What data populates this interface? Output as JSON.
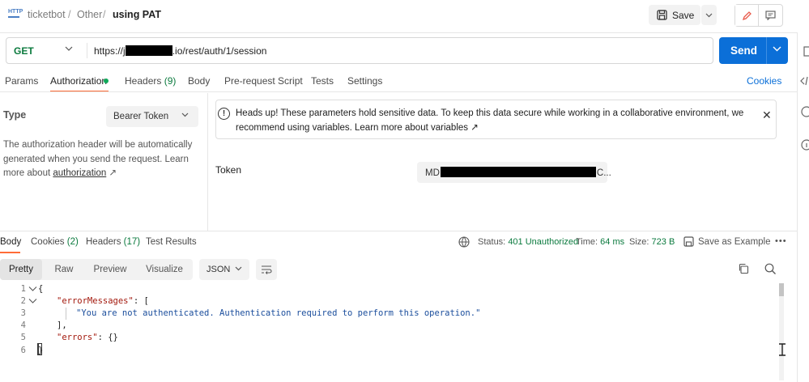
{
  "breadcrumb": {
    "collection": "ticketbot",
    "folder": "Other",
    "request": "using PAT",
    "separator": "/"
  },
  "toolbar": {
    "save_label": "Save"
  },
  "request": {
    "method": "GET",
    "url_prefix": "https://j",
    "url_suffix": ".io/rest/auth/1/session",
    "send_label": "Send"
  },
  "request_tabs": {
    "params": "Params",
    "authorization": "Authorization",
    "headers": "Headers",
    "headers_count": "(9)",
    "body": "Body",
    "prerequest": "Pre-request Script",
    "tests": "Tests",
    "settings": "Settings",
    "cookies": "Cookies"
  },
  "auth": {
    "type_label": "Type",
    "type_value": "Bearer Token",
    "description": "The authorization header will be automatically generated when you send the request. Learn more about",
    "description_link": "authorization",
    "link_arrow": "↗",
    "banner_text": "Heads up! These parameters hold sensitive data. To keep this data secure while working in a collaborative environment, we recommend using variables. Learn more about",
    "banner_link": "variables",
    "token_label": "Token",
    "token_prefix": "MD",
    "token_suffix": "C..."
  },
  "response_tabs": {
    "body": "Body",
    "cookies": "Cookies",
    "cookies_count": "(2)",
    "headers": "Headers",
    "headers_count": "(17)",
    "test_results": "Test Results"
  },
  "response_meta": {
    "status_label": "Status:",
    "status_value": "401 Unauthorized",
    "time_label": "Time:",
    "time_value": "64 ms",
    "size_label": "Size:",
    "size_value": "723 B",
    "save_example": "Save as Example",
    "more": "•••"
  },
  "format": {
    "pretty": "Pretty",
    "raw": "Raw",
    "preview": "Preview",
    "visualize": "Visualize",
    "language": "JSON"
  },
  "code": {
    "line_numbers": [
      "1",
      "2",
      "3",
      "4",
      "5",
      "6"
    ],
    "l1": "{",
    "l2_key": "\"errorMessages\"",
    "l2_rest": ": [",
    "l3": "\"You are not authenticated. Authentication required to perform this operation.\"",
    "l4": "],",
    "l5_key": "\"errors\"",
    "l5_rest": ": {}",
    "l6": "}"
  },
  "icons": {
    "http": "HTTP",
    "info": "!",
    "close": "✕"
  }
}
